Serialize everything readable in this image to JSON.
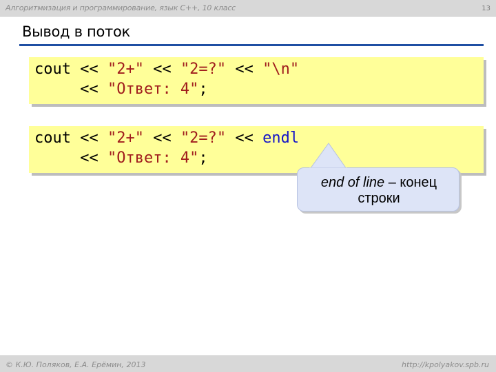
{
  "header": {
    "course": "Алгоритмизация и программирование, язык С++, 10 класс",
    "page_number": "13"
  },
  "slide": {
    "title": "Вывод в поток"
  },
  "code_block_1": {
    "line1": {
      "cout": "cout",
      "op1": " << ",
      "s1": "\"2+\"",
      "op2": " << ",
      "s2": "\"2=?\"",
      "op3": " << ",
      "s3": "\"\\n\""
    },
    "line2": {
      "indent_op": "     << ",
      "s4": "\"Ответ: 4\"",
      "end": ";"
    }
  },
  "code_block_2": {
    "line1": {
      "cout": "cout",
      "op1": " << ",
      "s1": "\"2+\"",
      "op2": " << ",
      "s2": "\"2=?\"",
      "op3": " << ",
      "kw": "endl"
    },
    "line2": {
      "indent_op": "     << ",
      "s4": "\"Ответ: 4\"",
      "end": ";"
    }
  },
  "callout": {
    "italic": "end of line",
    "rest": " – конец",
    "line2": "строки"
  },
  "footer": {
    "copyright": "© К.Ю. Поляков, Е.А. Ерёмин, 2013",
    "site": "http://kpolyakov.spb.ru"
  },
  "colors": {
    "code_background": "#ffff99",
    "string_literal": "#a01d1d",
    "keyword": "#1414c8",
    "title_rule": "#1f4fa3",
    "callout_fill": "#dde4f7"
  }
}
